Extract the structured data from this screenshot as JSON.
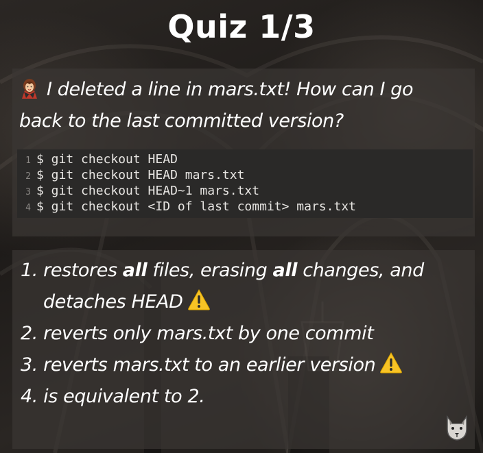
{
  "slide": {
    "title": "Quiz 1/3",
    "question": {
      "emoji": "woman-vampire",
      "line1": "I deleted a line in mars.txt! How can I go",
      "line2": "back to the last committed version?"
    },
    "code": [
      {
        "num": "1",
        "text": "$ git checkout HEAD"
      },
      {
        "num": "2",
        "text": "$ git checkout HEAD mars.txt"
      },
      {
        "num": "3",
        "text": "$ git checkout HEAD~1 mars.txt"
      },
      {
        "num": "4",
        "text": "$ git checkout <ID of last commit> mars.txt"
      }
    ],
    "answers": {
      "a1_part1": "1. restores ",
      "a1_bold1": "all",
      "a1_part2": " files, erasing ",
      "a1_bold2": "all",
      "a1_part3": " changes, and",
      "a1_line2": "detaches HEAD",
      "a2": "2. reverts only mars.txt by one commit",
      "a3": "3. reverts mars.txt to an earlier version",
      "a4": "4. is equivalent to 2."
    },
    "icons": {
      "warning": "warning-icon",
      "mascot": "wolf-mascot-icon"
    },
    "colors": {
      "warning_yellow": "#f7c325",
      "code_bg": "#2a2928"
    }
  }
}
